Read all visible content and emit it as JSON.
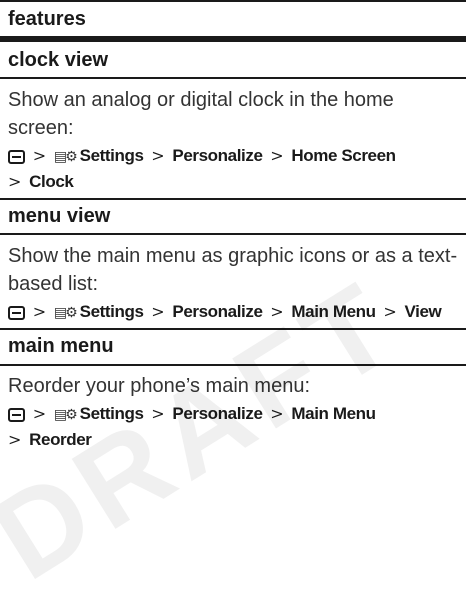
{
  "header": {
    "title": "features"
  },
  "path_parts": {
    "separator": ">",
    "settings_icon": "▤⚙",
    "settings": "Settings",
    "personalize": "Personalize",
    "menu_key_icon": "menu-key-icon",
    "settings_icon_name": "settings-icon"
  },
  "sections": [
    {
      "title": "clock view",
      "description": "Show an analog or digital clock in the home screen:",
      "path_rest_1": "Home Screen",
      "path_rest_2": "Clock"
    },
    {
      "title": "menu view",
      "description": "Show the main menu as graphic icons or as a text-based list:",
      "path_rest_1": "Main Menu",
      "path_rest_2": "View"
    },
    {
      "title": "main menu",
      "description": "Reorder your phone’s main menu:",
      "path_rest_1": "Main Menu",
      "path_rest_2": "Reorder"
    }
  ],
  "watermark": "DRAFT"
}
